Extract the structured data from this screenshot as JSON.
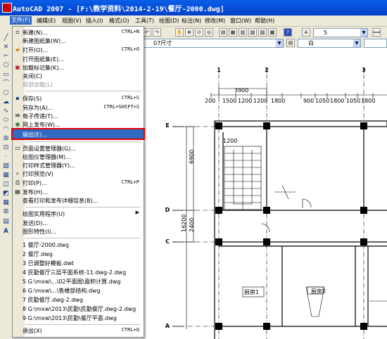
{
  "window": {
    "title": "AutoCAD 2007 - [F:\\教学资料\\2014-2-19\\餐厅-2000.dwg]"
  },
  "menubar": [
    "文件(F)",
    "编辑(E)",
    "视图(V)",
    "插入(I)",
    "格式(O)",
    "工具(T)",
    "绘图(D)",
    "标注(N)",
    "修改(M)",
    "窗口(W)",
    "帮助(H)"
  ],
  "toolbar": {
    "textstyle_value": "5",
    "layer_value": "07尺寸",
    "color_value": "白"
  },
  "file_menu": {
    "items": [
      {
        "label": "新建(N)...",
        "shortcut": "CTRL+N"
      },
      {
        "label": "新建图纸集(W)...",
        "shortcut": ""
      },
      {
        "label": "打开(O)...",
        "shortcut": "CTRL+O"
      },
      {
        "label": "打开图纸集(E)...",
        "shortcut": ""
      },
      {
        "label": "加载标记集(K)...",
        "shortcut": ""
      },
      {
        "label": "关闭(C)",
        "shortcut": ""
      },
      {
        "label": "局部加载(L)",
        "shortcut": ""
      },
      {
        "label": "保存(S)",
        "shortcut": "CTRL+S"
      },
      {
        "label": "另存为(A)...",
        "shortcut": "CTRL+SHIFT+S"
      },
      {
        "label": "电子传递(T)...",
        "shortcut": ""
      },
      {
        "label": "网上发布(W)...",
        "shortcut": ""
      },
      {
        "label": "输出(E)...",
        "shortcut": ""
      },
      {
        "label": "页面设置管理器(G)...",
        "shortcut": ""
      },
      {
        "label": "绘图仪管理器(M)...",
        "shortcut": ""
      },
      {
        "label": "打印样式管理器(Y)...",
        "shortcut": ""
      },
      {
        "label": "打印预览(V)",
        "shortcut": ""
      },
      {
        "label": "打印(P)...",
        "shortcut": "CTRL+P"
      },
      {
        "label": "发布(H)...",
        "shortcut": ""
      },
      {
        "label": "查看打印和发布详细信息(B)...",
        "shortcut": ""
      },
      {
        "label": "绘图实用程序(U)",
        "shortcut": ""
      },
      {
        "label": "发送(D)...",
        "shortcut": ""
      },
      {
        "label": "图形特性(I)...",
        "shortcut": ""
      },
      {
        "label": "1 餐厅-2000.dwg",
        "shortcut": ""
      },
      {
        "label": "2 餐厅.dwg",
        "shortcut": ""
      },
      {
        "label": "3 已调整好模板.dwt",
        "shortcut": ""
      },
      {
        "label": "4 民勤餐厅三层平面系统-11.dwg-2.dwg",
        "shortcut": ""
      },
      {
        "label": "5 G:\\mxw\\...\\02平面图\\面积计算.dwg",
        "shortcut": ""
      },
      {
        "label": "6 G:\\mxw\\...\\售楼部结构.dwg",
        "shortcut": ""
      },
      {
        "label": "7 民勤餐厅.dwg-2.dwg",
        "shortcut": ""
      },
      {
        "label": "8 G:\\mxw\\2013\\民勤\\民勤餐厅.dwg-2.dwg",
        "shortcut": ""
      },
      {
        "label": "9 G:\\mxw\\2013\\民勤\\餐厅平面.dwg",
        "shortcut": ""
      },
      {
        "label": "退出(X)",
        "shortcut": "CTRL+Q"
      }
    ]
  },
  "drawing": {
    "axis_numbers": [
      "1",
      "2",
      "3"
    ],
    "axis_letters": [
      "E",
      "D",
      "C",
      "A"
    ],
    "dim_top_overall": "3900",
    "dim_top_segments": [
      "200",
      "1500",
      "1200",
      "1200",
      "1800",
      "900",
      "1050",
      "1800",
      "1050",
      "1800"
    ],
    "dim_left": [
      "6900",
      "2400",
      "16200"
    ],
    "dim_stair": "1200",
    "room_labels": [
      "厨房2",
      "厨房1"
    ]
  }
}
